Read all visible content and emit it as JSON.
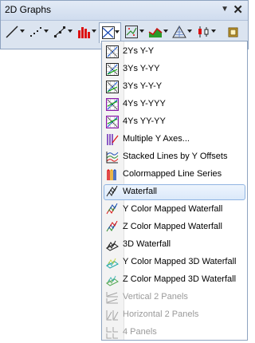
{
  "window": {
    "title": "2D Graphs"
  },
  "toolbar": {
    "tools": [
      {
        "icon": "line-plot-icon"
      },
      {
        "icon": "scatter-plot-icon"
      },
      {
        "icon": "line-symbol-plot-icon"
      },
      {
        "icon": "column-plot-icon"
      },
      {
        "icon": "multi-panel-plot-icon"
      },
      {
        "icon": "specialized-plot-icon"
      },
      {
        "icon": "area-plot-icon"
      },
      {
        "icon": "ternary-plot-icon"
      },
      {
        "icon": "stock-plot-icon"
      },
      {
        "icon": "template-library-icon"
      }
    ]
  },
  "menu": {
    "items": [
      {
        "label": "2Ys Y-Y",
        "icon": "double-y-icon",
        "disabled": false
      },
      {
        "label": "3Ys Y-YY",
        "icon": "triple-y-icon",
        "disabled": false
      },
      {
        "label": "3Ys Y-Y-Y",
        "icon": "triple-y-icon",
        "disabled": false
      },
      {
        "label": "4Ys Y-YYY",
        "icon": "quad-y-icon",
        "disabled": false
      },
      {
        "label": "4Ys YY-YY",
        "icon": "quad-y-icon",
        "disabled": false
      },
      {
        "label": "Multiple Y Axes...",
        "icon": "multiple-y-axes-icon",
        "disabled": false
      },
      {
        "label": "Stacked Lines by Y Offsets",
        "icon": "stacked-lines-icon",
        "disabled": false
      },
      {
        "label": "Colormapped Line Series",
        "icon": "colormapped-line-icon",
        "disabled": false
      },
      {
        "label": "Waterfall",
        "icon": "waterfall-icon",
        "disabled": false,
        "highlighted": true
      },
      {
        "label": "Y Color Mapped Waterfall",
        "icon": "y-color-waterfall-icon",
        "disabled": false
      },
      {
        "label": "Z Color Mapped Waterfall",
        "icon": "z-color-waterfall-icon",
        "disabled": false
      },
      {
        "label": "3D Waterfall",
        "icon": "3d-waterfall-icon",
        "disabled": false
      },
      {
        "label": "Y Color Mapped 3D Waterfall",
        "icon": "y-color-3d-waterfall-icon",
        "disabled": false
      },
      {
        "label": "Z Color Mapped 3D Waterfall",
        "icon": "z-color-3d-waterfall-icon",
        "disabled": false
      },
      {
        "label": "Vertical 2 Panels",
        "icon": "vertical-panels-icon",
        "disabled": true
      },
      {
        "label": "Horizontal 2 Panels",
        "icon": "horizontal-panels-icon",
        "disabled": true
      },
      {
        "label": "4 Panels",
        "icon": "four-panels-icon",
        "disabled": true
      }
    ]
  },
  "colors": {
    "highlight_border": "#8fb4e2",
    "disabled_text": "#9a9a9a"
  }
}
